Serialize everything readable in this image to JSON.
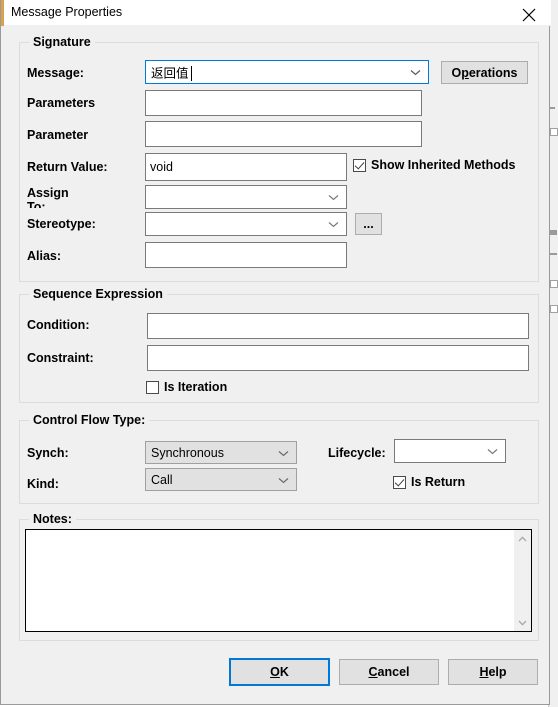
{
  "window": {
    "title": "Message Properties",
    "close_icon": "close-icon"
  },
  "groups": {
    "signature": {
      "title": "Signature"
    },
    "sequence_expression": {
      "title": "Sequence Expression"
    },
    "control_flow_type": {
      "title": "Control Flow Type:"
    },
    "notes": {
      "title": "Notes:"
    }
  },
  "signature": {
    "message_label": "Message:",
    "message_value": "返回值",
    "operations_button": "Operations",
    "operations_accel": "p",
    "parameters_label": "Parameters",
    "parameters_value": "",
    "parameter_label": "Parameter",
    "parameter_value": "",
    "return_value_label": "Return Value:",
    "return_value": "void",
    "show_inherited_label": "Show Inherited Methods",
    "show_inherited_checked": true,
    "assign_to_label": "Assign To:",
    "assign_to_value": "",
    "stereotype_label": "Stereotype:",
    "stereotype_value": "",
    "stereotype_browse_button": "...",
    "alias_label": "Alias:",
    "alias_value": ""
  },
  "sequence": {
    "condition_label": "Condition:",
    "condition_value": "",
    "constraint_label": "Constraint:",
    "constraint_value": "",
    "is_iteration_label": "Is Iteration",
    "is_iteration_checked": false
  },
  "control_flow": {
    "synch_label": "Synch:",
    "synch_value": "Synchronous",
    "kind_label": "Kind:",
    "kind_value": "Call",
    "lifecycle_label": "Lifecycle:",
    "lifecycle_value": "",
    "is_return_label": "Is Return",
    "is_return_checked": true
  },
  "notes": {
    "value": ""
  },
  "footer": {
    "ok_label": "OK",
    "ok_accel": "O",
    "cancel_label": "Cancel",
    "cancel_accel": "C",
    "help_label": "Help",
    "help_accel": "H"
  },
  "colors": {
    "dialog_bg": "#f0f0f0",
    "focus_blue": "#0078d7",
    "title_accent": "#d8a24a",
    "button_face": "#e1e1e1",
    "disabled_combo": "#e1e1e1"
  }
}
